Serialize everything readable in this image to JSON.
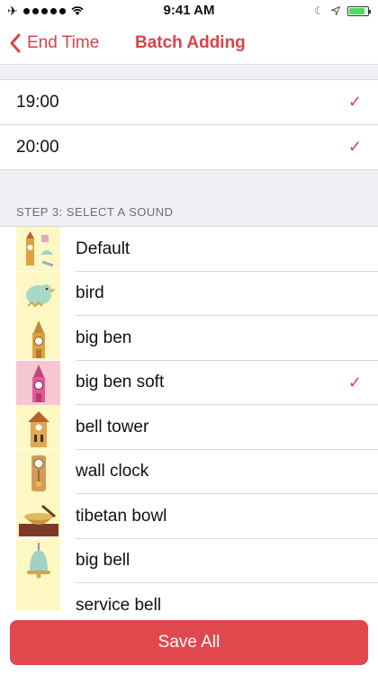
{
  "status_bar": {
    "time": "9:41 AM",
    "battery_level": 0.85,
    "icons": [
      "airplane-icon",
      "signal-dots-icon",
      "wifi-icon",
      "moon-icon",
      "location-icon",
      "battery-icon"
    ]
  },
  "nav": {
    "back_label": "End Time",
    "title": "Batch Adding"
  },
  "times": [
    {
      "label": "19:00",
      "checked": true
    },
    {
      "label": "20:00",
      "checked": true
    }
  ],
  "section": {
    "header": "STEP 3: SELECT A SOUND"
  },
  "sounds": [
    {
      "label": "Default",
      "icon": "default-sounds-icon",
      "checked": false
    },
    {
      "label": "bird",
      "icon": "bird-icon",
      "checked": false
    },
    {
      "label": "big ben",
      "icon": "big-ben-icon",
      "checked": false
    },
    {
      "label": "big ben soft",
      "icon": "big-ben-soft-icon",
      "checked": true
    },
    {
      "label": "bell tower",
      "icon": "bell-tower-icon",
      "checked": false
    },
    {
      "label": "wall clock",
      "icon": "wall-clock-icon",
      "checked": false
    },
    {
      "label": "tibetan bowl",
      "icon": "tibetan-bowl-icon",
      "checked": false
    },
    {
      "label": "big bell",
      "icon": "big-bell-icon",
      "checked": false
    },
    {
      "label": "service bell",
      "icon": "service-bell-icon",
      "checked": false
    }
  ],
  "checkmark": "✓",
  "footer": {
    "save_label": "Save All"
  },
  "colors": {
    "accent": "#d9434a",
    "button": "#e0484e",
    "thumb_yellow": "#fdf7c3",
    "thumb_pink": "#f6c6d2",
    "grouped_background": "#efeff4"
  }
}
